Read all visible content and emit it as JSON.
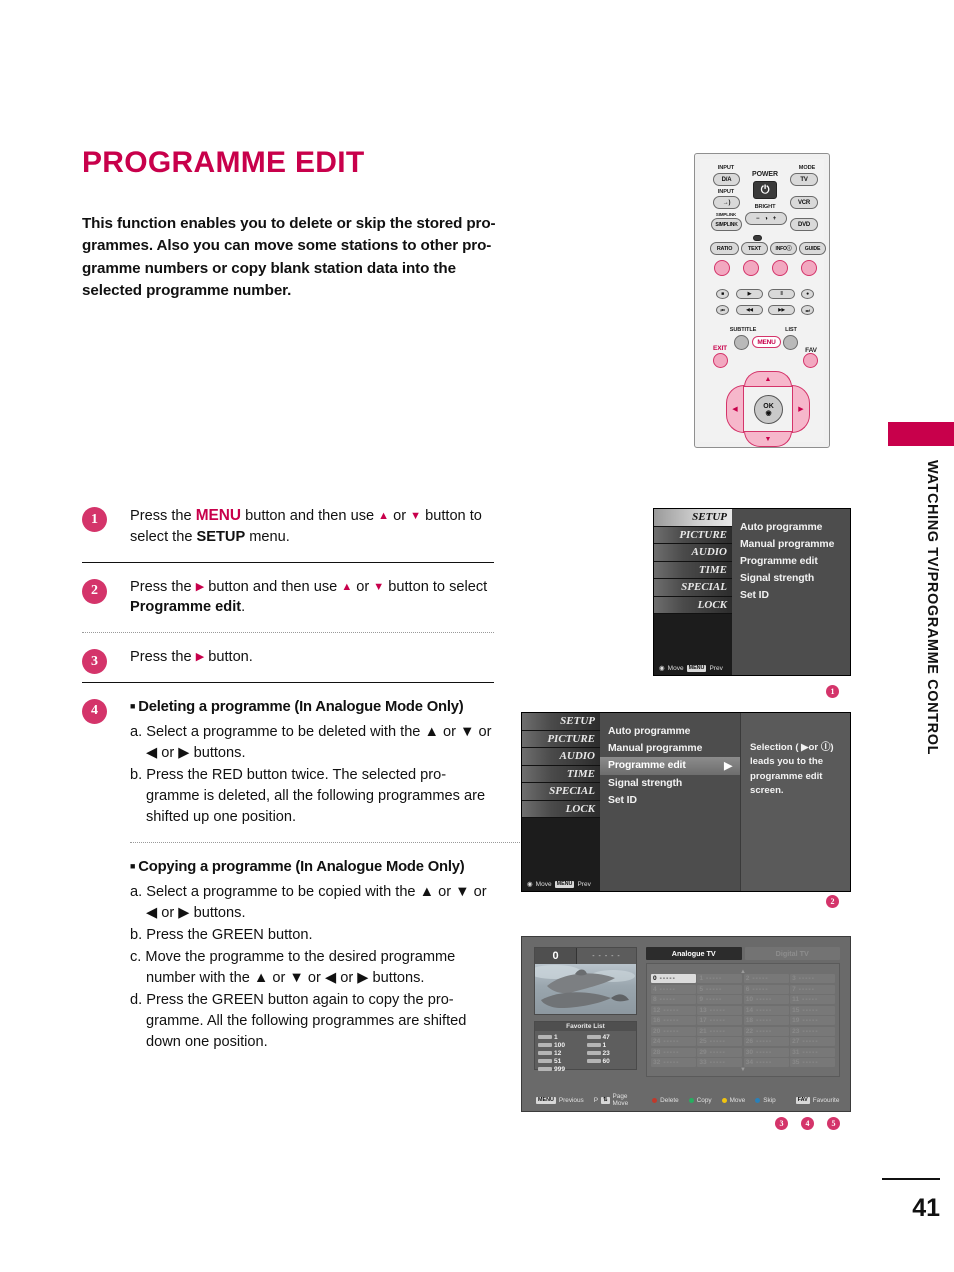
{
  "page": {
    "title": "PROGRAMME EDIT",
    "intro": "This function enables you to delete or skip the stored pro-grammes. Also you can move some stations to other pro-gramme numbers or copy blank station data into the selected programme number.",
    "side_tab_text": "WATCHING TV/PROGRAMME CONTROL",
    "page_number": "41"
  },
  "steps": [
    {
      "number": "1",
      "text_parts": [
        "Press the ",
        "MENU",
        " button and then use ",
        "▲",
        " or ",
        "▼",
        " button to select the ",
        "SETUP",
        " menu."
      ]
    },
    {
      "number": "2",
      "text_parts": [
        "Press the ",
        "▶",
        " button and then use ",
        "▲",
        " or ",
        "▼",
        " button to select  ",
        "Programme edit",
        "."
      ]
    },
    {
      "number": "3",
      "text_parts": [
        "Press the ",
        "▶",
        " button."
      ]
    }
  ],
  "step4": {
    "number": "4",
    "section_delete": {
      "heading": "Deleting a programme (In Analogue Mode Only)",
      "items": [
        "a. Select a programme to be deleted with the ▲ or ▼ or ◀ or ▶ buttons.",
        "b. Press the RED button twice. The selected pro-gramme is deleted, all the following programmes are shifted up one position."
      ]
    },
    "section_copy": {
      "heading": "Copying a programme (In Analogue Mode Only)",
      "items": [
        "a. Select a programme to be copied with the ▲ or ▼ or ◀ or ▶ buttons.",
        "b. Press the GREEN button.",
        "c. Move the programme to the desired programme number with the ▲ or ▼ or ◀ or ▶ buttons.",
        "d. Press the GREEN button again to copy the pro-gramme. All the following programmes are shifted down one position."
      ]
    }
  },
  "remote": {
    "labels": {
      "input": "INPUT",
      "input2": "INPUT",
      "mode": "MODE",
      "power": "POWER",
      "bright": "BRIGHT",
      "simplink": "SIMPLINK",
      "subtitle": "SUBTITLE",
      "list": "LIST"
    },
    "buttons": [
      {
        "name": "da-button",
        "label": "D/A"
      },
      {
        "name": "input-button",
        "label": "→)"
      },
      {
        "name": "simplink-button",
        "label": "SIMPLINK"
      },
      {
        "name": "ratio-button",
        "label": "RATIO"
      },
      {
        "name": "text-button",
        "label": "TEXT"
      },
      {
        "name": "info-button",
        "label": "INFOⒾ"
      },
      {
        "name": "guide-button",
        "label": "GUIDE"
      },
      {
        "name": "tv-button",
        "label": "TV"
      },
      {
        "name": "vcr-button",
        "label": "VCR"
      },
      {
        "name": "dvd-button",
        "label": "DVD"
      },
      {
        "name": "power-button",
        "label": "⏻"
      },
      {
        "name": "bright-minus",
        "label": "−"
      },
      {
        "name": "bright-icon",
        "label": "◑"
      },
      {
        "name": "bright-plus",
        "label": "+"
      },
      {
        "name": "exit-button",
        "label": "EXIT"
      },
      {
        "name": "menu-button",
        "label": "MENU"
      },
      {
        "name": "fav-button",
        "label": "FAV"
      },
      {
        "name": "ok-button",
        "label": "OK"
      }
    ],
    "transport": [
      {
        "name": "stop-button",
        "label": "■"
      },
      {
        "name": "play-button",
        "label": "▶"
      },
      {
        "name": "pause-button",
        "label": "‖"
      },
      {
        "name": "record-button",
        "label": "●"
      },
      {
        "name": "prev-button",
        "label": "⏮"
      },
      {
        "name": "rewind-button",
        "label": "◀◀"
      },
      {
        "name": "forward-button",
        "label": "▶▶"
      },
      {
        "name": "next-button",
        "label": "⏭"
      }
    ]
  },
  "tv_menu_1": {
    "marker": "1",
    "left_items": [
      {
        "label": "SETUP",
        "selected": true
      },
      {
        "label": "PICTURE",
        "selected": false
      },
      {
        "label": "AUDIO",
        "selected": false
      },
      {
        "label": "TIME",
        "selected": false
      },
      {
        "label": "SPECIAL",
        "selected": false
      },
      {
        "label": "LOCK",
        "selected": false
      }
    ],
    "right_items": [
      {
        "label": "Auto programme",
        "selected": false
      },
      {
        "label": "Manual programme",
        "selected": false
      },
      {
        "label": "Programme edit",
        "selected": false
      },
      {
        "label": "Signal strength",
        "selected": false
      },
      {
        "label": "Set ID",
        "selected": false
      }
    ],
    "footer": {
      "move": "Move",
      "menu_key": "MENU",
      "prev": "Prev"
    }
  },
  "tv_menu_2": {
    "marker": "2",
    "left_items": [
      {
        "label": "SETUP",
        "selected": false
      },
      {
        "label": "PICTURE",
        "selected": false
      },
      {
        "label": "AUDIO",
        "selected": false
      },
      {
        "label": "TIME",
        "selected": false
      },
      {
        "label": "SPECIAL",
        "selected": false
      },
      {
        "label": "LOCK",
        "selected": false
      }
    ],
    "right_items": [
      {
        "label": "Auto programme",
        "selected": false
      },
      {
        "label": "Manual programme",
        "selected": false
      },
      {
        "label": "Programme edit",
        "selected": true,
        "arrow": "▶"
      },
      {
        "label": "Signal strength",
        "selected": false
      },
      {
        "label": "Set ID",
        "selected": false
      }
    ],
    "help_text": "Selection ( ▶or Ⓘ) leads you to the programme edit screen.",
    "footer": {
      "move": "Move",
      "menu_key": "MENU",
      "prev": "Prev"
    }
  },
  "programme_edit_screen": {
    "markers": [
      "3",
      "4",
      "5"
    ],
    "preview": {
      "channel": "0",
      "name": "- - - - -"
    },
    "favorite_list": {
      "title": "Favorite List",
      "entries": [
        "1",
        "47",
        "100",
        "1",
        "12",
        "23",
        "51",
        "60",
        "999"
      ]
    },
    "tabs": [
      {
        "label": "Analogue TV",
        "active": true
      },
      {
        "label": "Digital TV",
        "active": false
      }
    ],
    "grid": {
      "dash": "- - - - -",
      "selected_index": 0,
      "numbers": [
        "0",
        "1",
        "2",
        "3",
        "4",
        "5",
        "6",
        "7",
        "8",
        "9",
        "10",
        "11",
        "12",
        "13",
        "14",
        "15",
        "16",
        "17",
        "18",
        "19",
        "20",
        "21",
        "22",
        "23",
        "24",
        "25",
        "26",
        "27",
        "28",
        "29",
        "30",
        "31",
        "32",
        "33",
        "34",
        "35"
      ]
    },
    "footer": [
      {
        "key": "MENU",
        "label": "Previous"
      },
      {
        "key": "P",
        "label": "Page Move"
      },
      {
        "key": "",
        "label": "Delete",
        "color": "#c0392b"
      },
      {
        "key": "",
        "label": "Copy",
        "color": "#27ae60"
      },
      {
        "key": "",
        "label": "Move",
        "color": "#f1c40f"
      },
      {
        "key": "",
        "label": "Skip",
        "color": "#2980b9"
      },
      {
        "key": "FAV",
        "label": "Favourite"
      }
    ]
  }
}
